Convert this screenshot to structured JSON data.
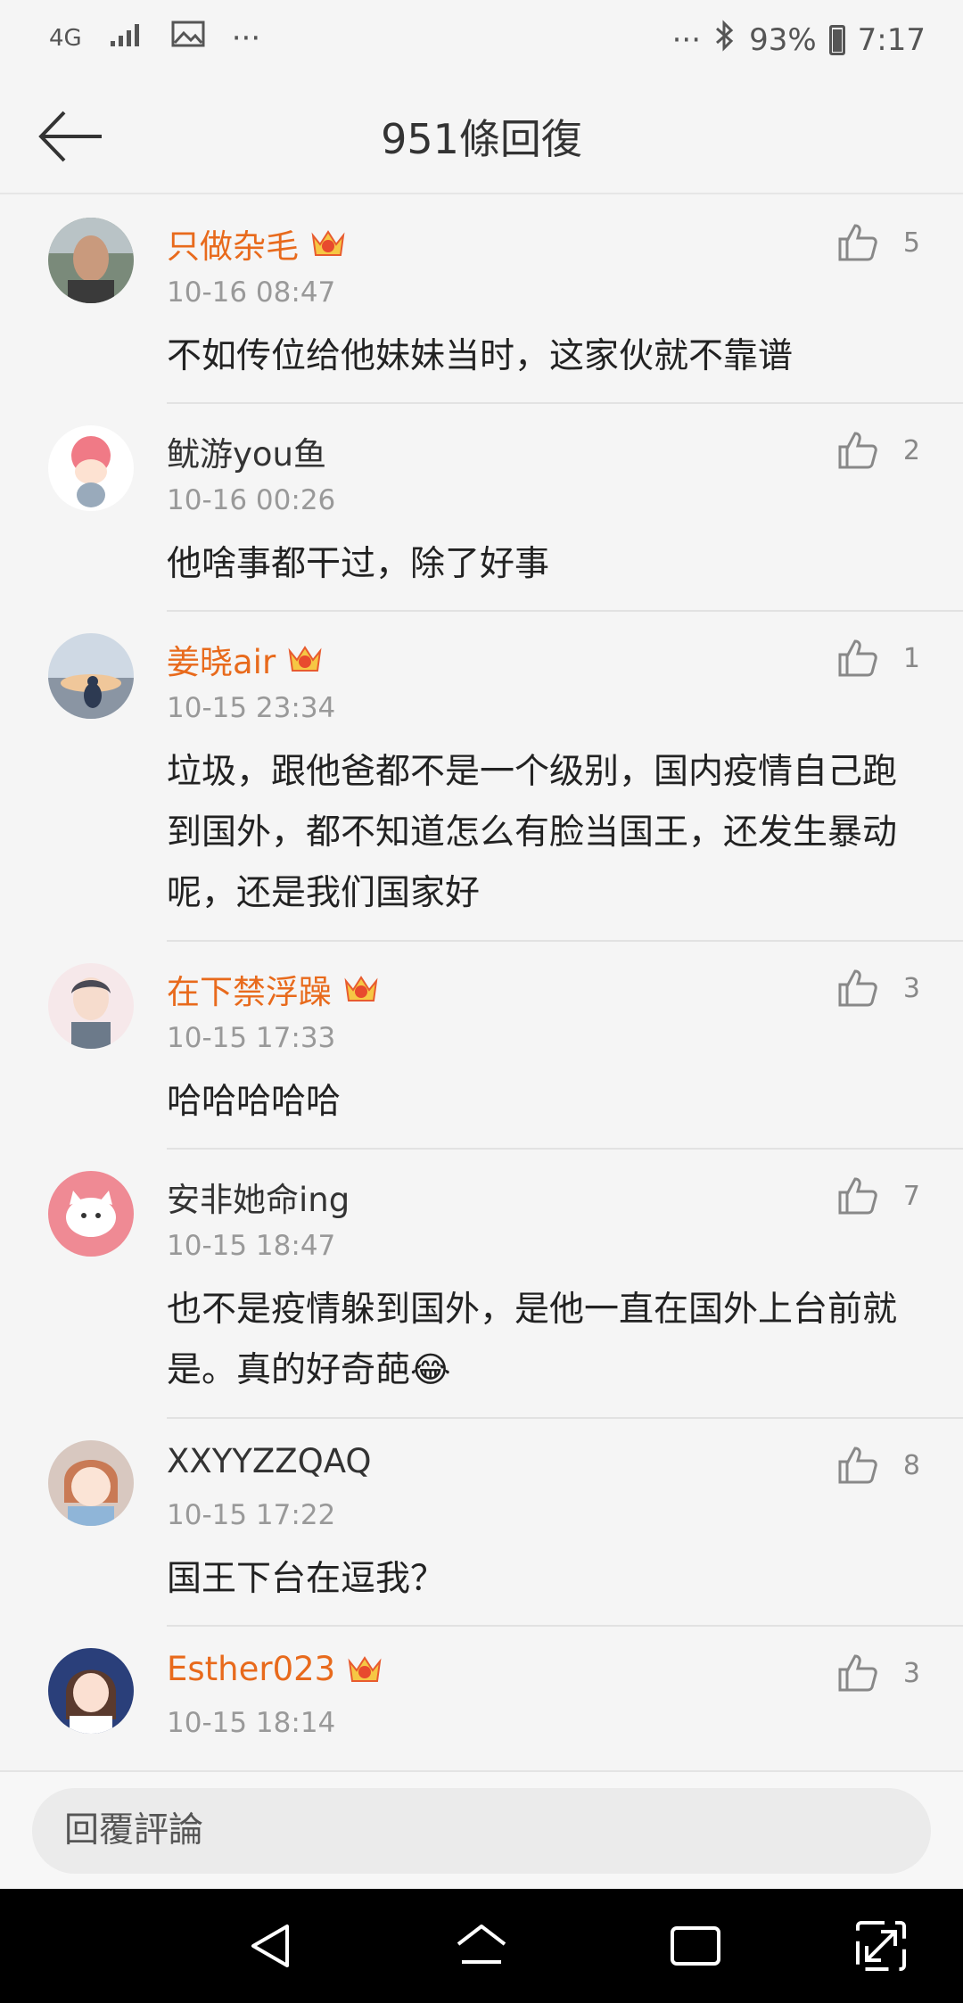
{
  "status_bar": {
    "network": "4G",
    "more": "···",
    "more_right": "···",
    "battery": "93%",
    "time": "7:17"
  },
  "header": {
    "title": "951條回復"
  },
  "comments": [
    {
      "name": "只做杂毛",
      "vip": true,
      "time": "10-16 08:47",
      "text": "不如传位给他妹妹当时，这家伙就不靠谱",
      "likes": "5"
    },
    {
      "name": "鱿游you鱼",
      "vip": false,
      "time": "10-16 00:26",
      "text": "他啥事都干过，除了好事",
      "likes": "2"
    },
    {
      "name": "姜晓air",
      "vip": true,
      "time": "10-15 23:34",
      "text": "垃圾，跟他爸都不是一个级别，国内疫情自己跑到国外，都不知道怎么有脸当国王，还发生暴动呢，还是我们国家好",
      "likes": "1"
    },
    {
      "name": "在下禁浮躁",
      "vip": true,
      "time": "10-15 17:33",
      "text": "哈哈哈哈哈",
      "likes": "3"
    },
    {
      "name": "安非她命ing",
      "vip": false,
      "time": "10-15 18:47",
      "text": "也不是疫情躲到国外，是他一直在国外上台前就是。真的好奇葩😂",
      "likes": "7"
    },
    {
      "name": "XXYYZZQAQ",
      "vip": false,
      "time": "10-15 17:22",
      "text": "国王下台在逗我？",
      "likes": "8"
    },
    {
      "name": "Esther023",
      "vip": true,
      "time": "10-15 18:14",
      "text": "",
      "likes": "3"
    }
  ],
  "reply_bar": {
    "placeholder": "回覆評論"
  },
  "colors": {
    "vip_name": "#e86a1c",
    "background": "#f5f5f5"
  }
}
